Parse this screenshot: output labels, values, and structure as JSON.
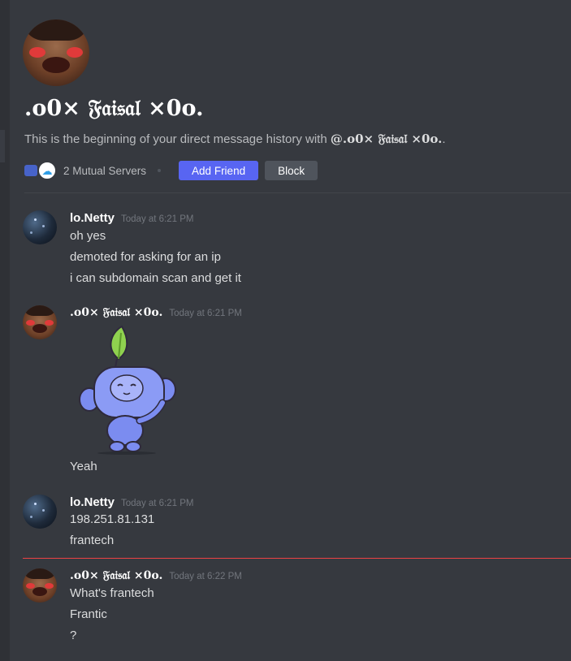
{
  "header": {
    "title": ".o0× 𝔉𝔞𝔦𝔰𝔞𝔩 ×0o.",
    "intro_prefix": "This is the beginning of your direct message history with ",
    "intro_user": "@.o0× 𝔉𝔞𝔦𝔰𝔞𝔩 ×0o.",
    "intro_suffix": ".",
    "mutual_servers": "2 Mutual Servers",
    "add_friend": "Add Friend",
    "block": "Block"
  },
  "messages": [
    {
      "author": "lo.Netty",
      "timestamp": "Today at 6:21 PM",
      "lines": [
        "oh yes",
        "demoted for asking for an ip",
        "i can subdomain scan and get it"
      ]
    },
    {
      "author": ".o0× 𝔉𝔞𝔦𝔰𝔞𝔩 ×0o.",
      "timestamp": "Today at 6:21 PM",
      "lines": [
        "Yeah"
      ],
      "sticker": "wumpus-waving-sticker"
    },
    {
      "author": "lo.Netty",
      "timestamp": "Today at 6:21 PM",
      "lines": [
        "198.251.81.131",
        "frantech"
      ]
    },
    {
      "author": ".o0× 𝔉𝔞𝔦𝔰𝔞𝔩 ×0o.",
      "timestamp": "Today at 6:22 PM",
      "lines": [
        "What's frantech",
        "Frantic",
        "?"
      ]
    }
  ],
  "colors": {
    "background": "#36393f",
    "accent": "#5865f2",
    "new_messages_divider": "#ed4245"
  }
}
